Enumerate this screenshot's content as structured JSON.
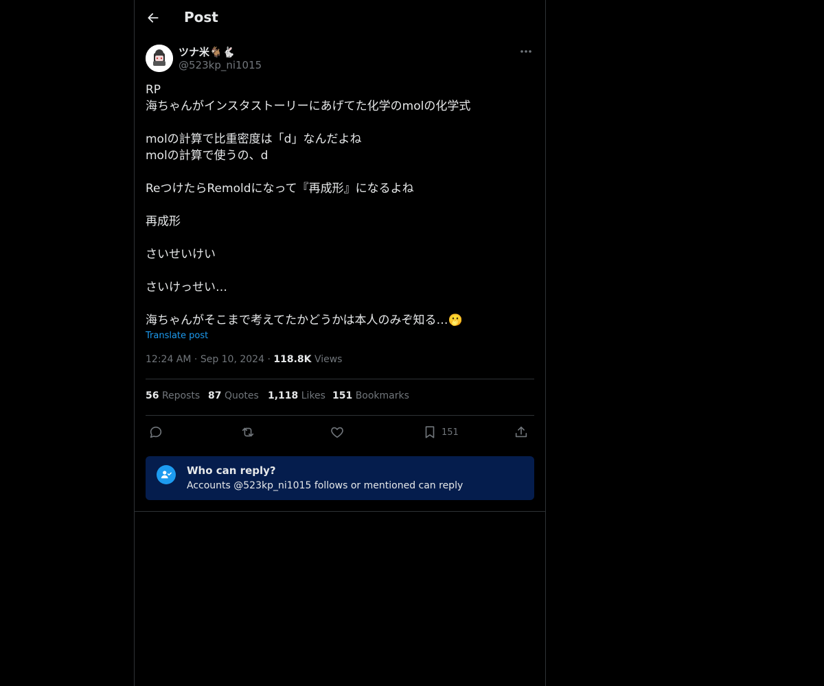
{
  "header": {
    "title": "Post"
  },
  "author": {
    "display_name": "ツナ米🐐🐇",
    "handle": "@523kp_ni1015"
  },
  "post": {
    "text": "RP\n海ちゃんがインスタストーリーにあげてた化学のmolの化学式\n\nmolの計算で比重密度は「d」なんだよね\nmolの計算で使うの、d\n\nReつけたらRemoldになって『再成形』になるよね\n\n再成形\n\nさいせいけい\n\nさいけっせい…\n\n海ちゃんがそこまで考えてたかどうかは本人のみぞ知る…🫢",
    "translate_label": "Translate post"
  },
  "meta": {
    "time": "12:24 AM",
    "date": "Sep 10, 2024",
    "views_count": "118.8K",
    "views_label": "Views"
  },
  "stats": [
    {
      "count": "56",
      "label": "Reposts"
    },
    {
      "count": "87",
      "label": "Quotes"
    },
    {
      "count": "1,118",
      "label": "Likes"
    },
    {
      "count": "151",
      "label": "Bookmarks"
    }
  ],
  "actions": {
    "bookmark_count": "151"
  },
  "reply_info": {
    "title": "Who can reply?",
    "subtitle": "Accounts @523kp_ni1015 follows or mentioned can reply"
  },
  "colors": {
    "accent": "#1d9bf0",
    "reply_box_bg": "#051d4d",
    "muted": "#71767b",
    "text": "#e7e9ea",
    "border": "#2f3336"
  },
  "icons": [
    "back-arrow-icon",
    "more-icon",
    "reply-icon",
    "repost-icon",
    "like-icon",
    "bookmark-icon",
    "share-icon",
    "person-check-icon"
  ]
}
